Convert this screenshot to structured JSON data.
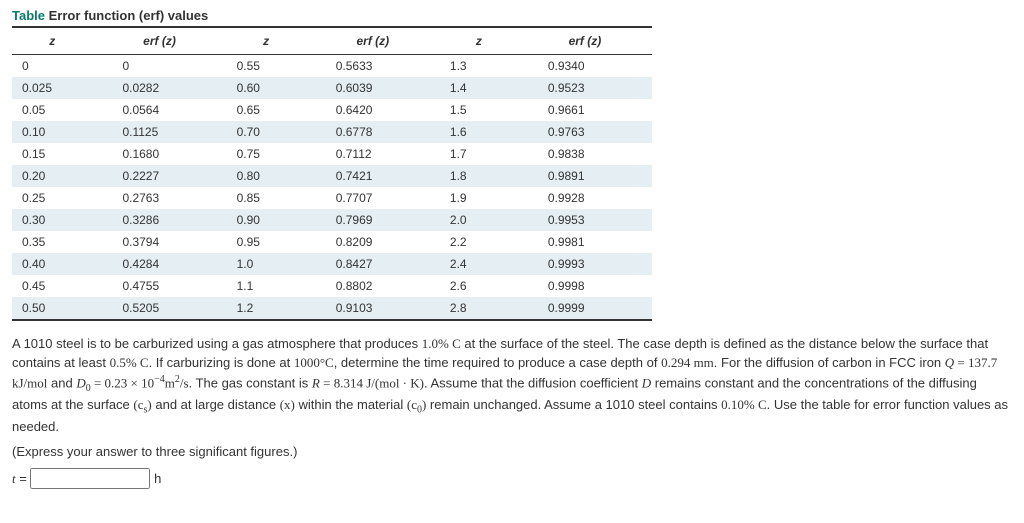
{
  "table": {
    "title_word": "Table",
    "title_rest": "Error function (erf) values",
    "headers": [
      "z",
      "erf (z)",
      "z",
      "erf (z)",
      "z",
      "erf (z)"
    ],
    "rows": [
      [
        "0",
        "0",
        "0.55",
        "0.5633",
        "1.3",
        "0.9340"
      ],
      [
        "0.025",
        "0.0282",
        "0.60",
        "0.6039",
        "1.4",
        "0.9523"
      ],
      [
        "0.05",
        "0.0564",
        "0.65",
        "0.6420",
        "1.5",
        "0.9661"
      ],
      [
        "0.10",
        "0.1125",
        "0.70",
        "0.6778",
        "1.6",
        "0.9763"
      ],
      [
        "0.15",
        "0.1680",
        "0.75",
        "0.7112",
        "1.7",
        "0.9838"
      ],
      [
        "0.20",
        "0.2227",
        "0.80",
        "0.7421",
        "1.8",
        "0.9891"
      ],
      [
        "0.25",
        "0.2763",
        "0.85",
        "0.7707",
        "1.9",
        "0.9928"
      ],
      [
        "0.30",
        "0.3286",
        "0.90",
        "0.7969",
        "2.0",
        "0.9953"
      ],
      [
        "0.35",
        "0.3794",
        "0.95",
        "0.8209",
        "2.2",
        "0.9981"
      ],
      [
        "0.40",
        "0.4284",
        "1.0",
        "0.8427",
        "2.4",
        "0.9993"
      ],
      [
        "0.45",
        "0.4755",
        "1.1",
        "0.8802",
        "2.6",
        "0.9998"
      ],
      [
        "0.50",
        "0.5205",
        "1.2",
        "0.9103",
        "2.8",
        "0.9999"
      ]
    ]
  },
  "problem": {
    "p1a": "A 1010 steel is to be carburized using a gas atmosphere that produces ",
    "v1": "1.0% C",
    "p1b": " at the surface of the steel. The case depth is defined as the distance below the surface that contains at least ",
    "v2": "0.5% C",
    "p1c": ". If carburizing is done at ",
    "v3": "1000°C",
    "p1d": ", determine the time required to produce a case depth of ",
    "v4": "0.294 mm",
    "p1e": ". For the diffusion of carbon in FCC iron ",
    "Ql": "Q",
    "Qv": " = 137.7 kJ/mol",
    "and": " and ",
    "D0l": "D",
    "D0sub": "0",
    "D0v": " = 0.23 × 10",
    "D0exp": "−4",
    "D0unit_a": "m",
    "D0unit_exp": "2",
    "D0unit_b": "/s",
    "p2a": ". The gas constant is ",
    "Rl": "R",
    "Rv": " = 8.314 J/(mol · K)",
    "p2b": ". Assume that the diffusion coefficient ",
    "Dl": "D",
    "p2c": " remains constant and the concentrations of the diffusing atoms at the surface ",
    "csl": "(c",
    "cssub": "s",
    "csr": ")",
    "p2d": " and at large distance ",
    "xl": "(x)",
    "p2e": " within the material ",
    "c0l": "(c",
    "c0sub": "0",
    "c0r": ")",
    "p2f": " remain unchanged. Assume a 1010 steel contains ",
    "v5": "0.10% C",
    "p2g": ". Use the table for error function values as needed.",
    "p3": "(Express your answer to three significant figures.)",
    "ans_var": "t",
    "ans_eq": " = ",
    "ans_unit": "h"
  }
}
